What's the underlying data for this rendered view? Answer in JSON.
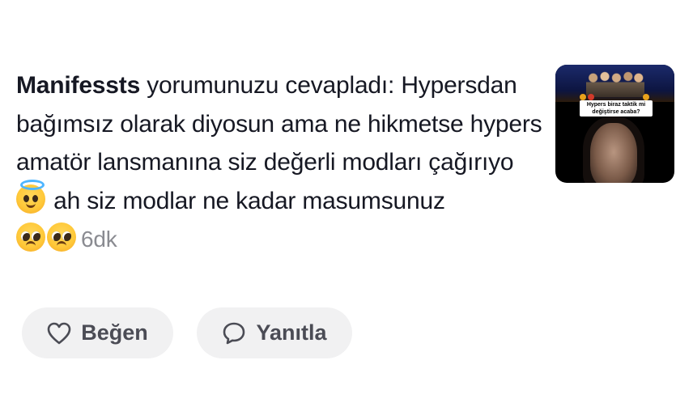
{
  "comment": {
    "username": "Manifessts",
    "text_after_username": " yorumunuzu cevapladı: Hypersdan bağımsız olarak diyosun ama ne hikmetse hypers amatör lansmanına siz değerli modları çağırıyo",
    "text_after_emoji": " ah siz modlar ne kadar masumsunuz",
    "emojis": [
      "smiling-face-with-halo",
      "pleading-face",
      "pleading-face"
    ],
    "timestamp": "6dk"
  },
  "thumbnail": {
    "caption": "Hypers biraz taktik mi değiştirse acaba?"
  },
  "actions": {
    "like_label": "Beğen",
    "reply_label": "Yanıtla"
  },
  "icons": {
    "like": "heart-icon",
    "reply": "speech-bubble-icon"
  },
  "colors": {
    "text": "#161823",
    "secondary_text": "#8a8b91",
    "button_bg": "#f1f1f2",
    "button_text": "#4b4c55"
  }
}
